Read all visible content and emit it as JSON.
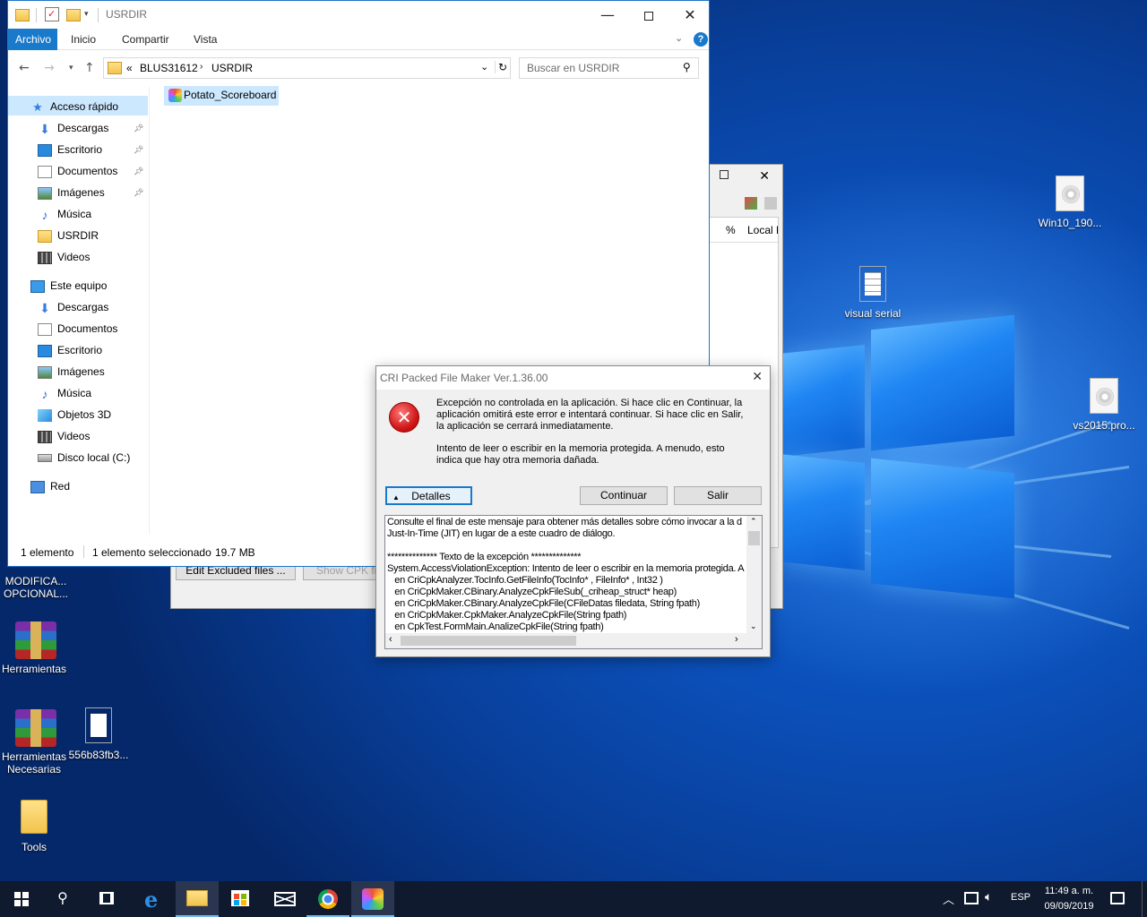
{
  "explorer": {
    "title": "USRDIR",
    "tabs": [
      "Archivo",
      "Inicio",
      "Compartir",
      "Vista"
    ],
    "breadcrumb": {
      "overflow": "«",
      "items": [
        "BLUS31612",
        "USRDIR"
      ]
    },
    "search_placeholder": "Buscar en USRDIR",
    "nav_items": [
      {
        "label": "Acceso rápido",
        "icon": "star-icon",
        "pinned": false
      },
      {
        "label": "Descargas",
        "icon": "download-icon",
        "pinned": true
      },
      {
        "label": "Escritorio",
        "icon": "desktop-icon",
        "pinned": true
      },
      {
        "label": "Documentos",
        "icon": "document-icon",
        "pinned": true
      },
      {
        "label": "Imágenes",
        "icon": "pictures-icon",
        "pinned": true
      },
      {
        "label": "Música",
        "icon": "music-icon",
        "pinned": false
      },
      {
        "label": "USRDIR",
        "icon": "folder-icon",
        "pinned": false
      },
      {
        "label": "Videos",
        "icon": "video-icon",
        "pinned": false
      },
      {
        "label": "Este equipo",
        "icon": "computer-icon",
        "pinned": false
      },
      {
        "label": "Descargas",
        "icon": "download-icon",
        "pinned": false
      },
      {
        "label": "Documentos",
        "icon": "document-icon",
        "pinned": false
      },
      {
        "label": "Escritorio",
        "icon": "desktop-icon",
        "pinned": false
      },
      {
        "label": "Imágenes",
        "icon": "pictures-icon",
        "pinned": false
      },
      {
        "label": "Música",
        "icon": "music-icon",
        "pinned": false
      },
      {
        "label": "Objetos 3D",
        "icon": "cube-icon",
        "pinned": false
      },
      {
        "label": "Videos",
        "icon": "video-icon",
        "pinned": false
      },
      {
        "label": "Disco local (C:)",
        "icon": "drive-icon",
        "pinned": false
      },
      {
        "label": "Red",
        "icon": "network-icon",
        "pinned": false
      }
    ],
    "files": [
      {
        "name": "Potato_Scoreboard",
        "selected": true
      }
    ],
    "status": {
      "count": "1 elemento",
      "selection": "1 elemento seleccionado",
      "size": "19.7 MB"
    }
  },
  "cpk_window": {
    "columns": [
      "%",
      "Local F"
    ],
    "buttons": [
      "Edit Excluded files ...",
      "Show CPK file ..."
    ]
  },
  "dialog": {
    "title": "CRI Packed File Maker Ver.1.36.00",
    "message1": "Excepción no controlada en la aplicación. Si hace clic en Continuar, la aplicación omitirá este error e intentará continuar. Si hace clic en Salir, la aplicación se cerrará inmediatamente.",
    "message2": "Intento de leer o escribir en la memoria protegida. A menudo, esto indica que hay otra memoria dañada.",
    "details_button": "Detalles",
    "continue_button": "Continuar",
    "exit_button": "Salir",
    "details_lines": [
      "Consulte el final de este mensaje para obtener más detalles sobre cómo invocar a la d",
      "Just-In-Time (JIT) en lugar de a este cuadro de diálogo.",
      "",
      "************** Texto de la excepción **************",
      "System.AccessViolationException: Intento de leer o escribir en la memoria protegida. A",
      "   en CriCpkAnalyzer.TocInfo.GetFileInfo(TocInfo* , FileInfo* , Int32 )",
      "   en CriCpkMaker.CBinary.AnalyzeCpkFileSub(_criheap_struct* heap)",
      "   en CriCpkMaker.CBinary.AnalyzeCpkFile(CFileDatas filedata, String fpath)",
      "   en CriCpkMaker.CpkMaker.AnalyzeCpkFile(String fpath)",
      "   en CpkTest.FormMain.AnalizeCpkFile(String fpath)"
    ]
  },
  "desktop_icons": [
    {
      "label": "Win10_190...",
      "icon": "disc-image-icon"
    },
    {
      "label": "visual serial",
      "icon": "text-file-icon"
    },
    {
      "label": "vs2015.pro...",
      "icon": "disc-image-icon"
    },
    {
      "label": "MODIFICA... OPCIONAL...",
      "icon": "folder-icon"
    },
    {
      "label": "Herramientas",
      "icon": "winrar-icon"
    },
    {
      "label": "Herramientas Necesarias",
      "icon": "winrar-icon"
    },
    {
      "label": "556b83fb3...",
      "icon": "image-file-icon"
    },
    {
      "label": "Tools",
      "icon": "folder-icon"
    }
  ],
  "taskbar": {
    "language": "ESP",
    "time": "11:49 a. m.",
    "date": "09/09/2019"
  }
}
